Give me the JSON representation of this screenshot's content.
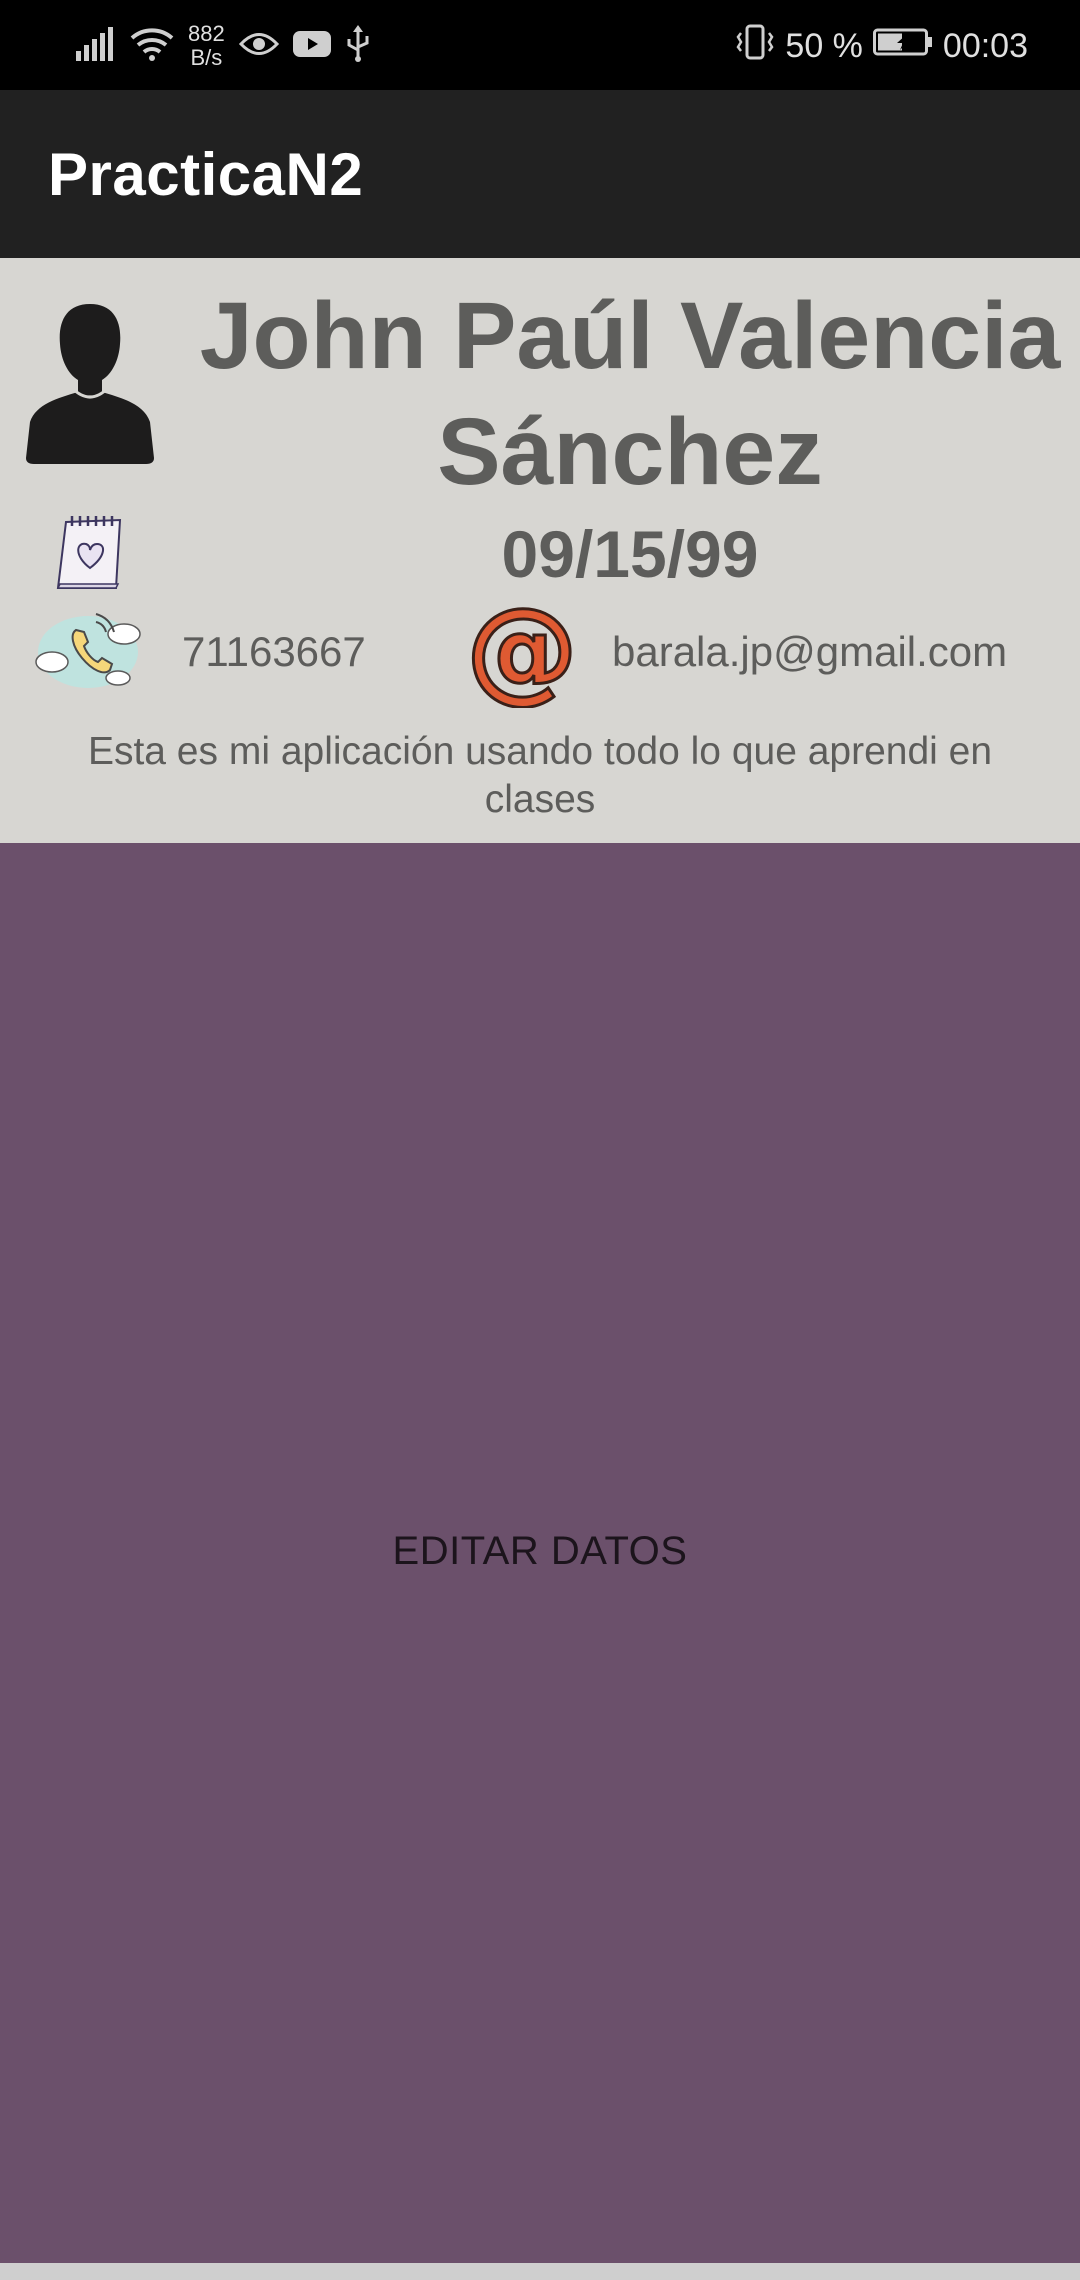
{
  "status_bar": {
    "net_speed_value": "882",
    "net_speed_unit": "B/s",
    "battery": "50 %",
    "time": "00:03",
    "icons": [
      "signal-icon",
      "wifi-icon",
      "eye-icon",
      "youtube-icon",
      "usb-icon",
      "vibrate-icon",
      "battery-icon"
    ]
  },
  "app_bar": {
    "title": "PracticaN2"
  },
  "profile": {
    "name": "John Paúl Valencia Sánchez",
    "birthdate": "09/15/99",
    "phone": "71163667",
    "email": "barala.jp@gmail.com",
    "description": "Esta es mi aplicación usando todo lo que aprendi en clases",
    "icons": [
      "avatar-icon",
      "calendar-heart-icon",
      "phone-icon",
      "at-sign-icon"
    ]
  },
  "edit_button": {
    "label": "EDITAR DATOS"
  },
  "colors": {
    "status_bar": "#000000",
    "app_bar": "#212121",
    "profile_bg": "#d7d6d2",
    "text": "#5d5d5b",
    "button_bg": "#6b506b",
    "button_text": "#1c141c"
  }
}
